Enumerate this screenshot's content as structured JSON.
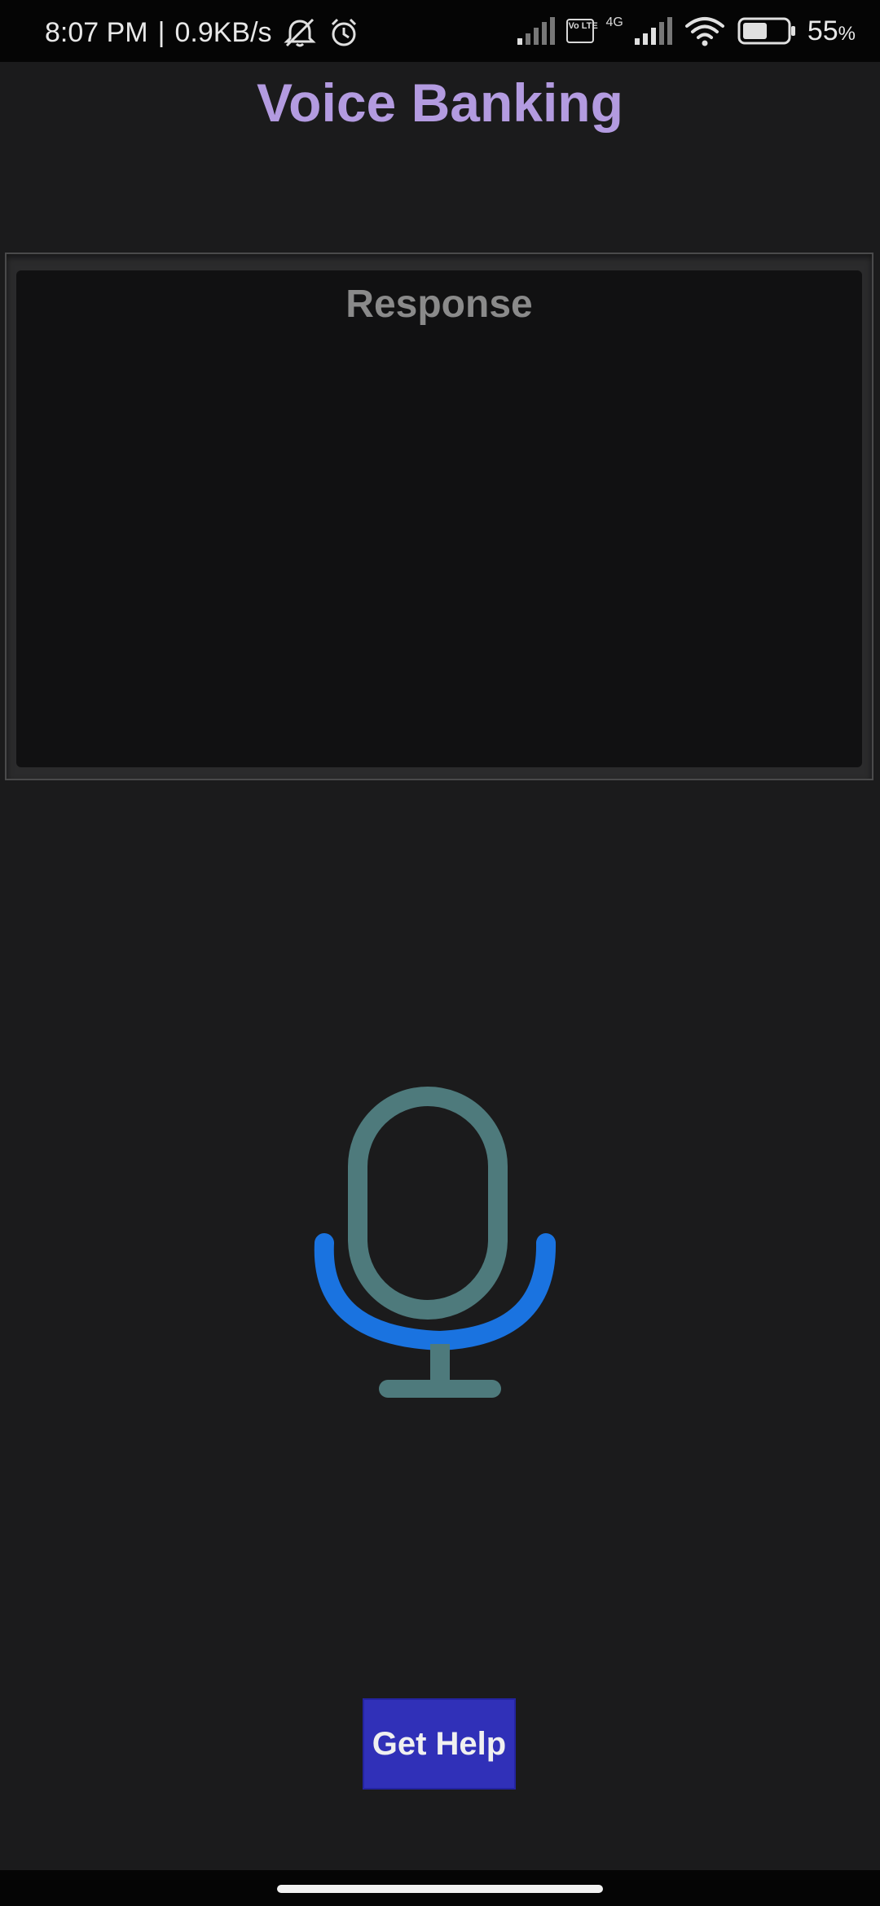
{
  "status_bar": {
    "time": "8:07 PM",
    "separator": "|",
    "speed": "0.9KB/s",
    "volte_label": "Vo LTE",
    "network_type": "4G",
    "battery_percent": "55",
    "battery_unit": "%",
    "battery_level": 0.55,
    "icons": [
      "mute-icon",
      "alarm-icon",
      "signal-icon",
      "volte-icon",
      "signal-icon",
      "wifi-icon",
      "battery-icon"
    ]
  },
  "header": {
    "title": "Voice Banking",
    "title_color": "#b39be0"
  },
  "response": {
    "label": "Response",
    "text": ""
  },
  "mic": {
    "icon": "microphone-icon",
    "capsule_color": "#4e7a7c",
    "arc_color": "#1a73e0"
  },
  "help": {
    "label": "Get Help",
    "color": "#3030b8"
  }
}
